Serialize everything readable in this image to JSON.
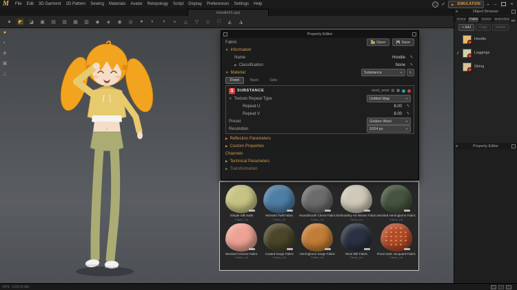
{
  "app": {
    "logo_text": "M",
    "menus": [
      "File",
      "Edit",
      "3D Garment",
      "2D Pattern",
      "Sewing",
      "Materials",
      "Avatar",
      "Retopology",
      "Script",
      "Display",
      "Preferences",
      "Settings",
      "Help"
    ],
    "document_tab": "Hoodie01.zprj",
    "simulation_label": "SIMULATION",
    "status_text": "FPS : 0.00 (0.0K)"
  },
  "toolbar": {
    "icons": [
      "▲",
      "◩",
      "◪",
      "▣",
      "▤",
      "▥",
      "▦",
      "▧",
      "◆",
      "◈",
      "◉",
      "◎",
      "●",
      "◐",
      "◑",
      "◒",
      "△",
      "▽",
      "◇",
      "□",
      "◭",
      "◮"
    ],
    "left_icons": [
      "●",
      "◐",
      "◈",
      "▣",
      "△"
    ]
  },
  "property_editor": {
    "title": "Property Editor",
    "fabric_label": "Fabric",
    "open_label": "Open",
    "save_label": "Save",
    "information": {
      "header": "Information",
      "name_label": "Name",
      "name_value": "Hoodie",
      "classification_label": "Classification",
      "classification_value": "None"
    },
    "material": {
      "header": "Material",
      "type_value": "Substance",
      "tabs": [
        "Front",
        "Back",
        "Side"
      ],
      "substance": {
        "brand": "SUBSTANCE",
        "file_name": "wool_wovi",
        "texture_repeat_label": "Texture Repeat Type",
        "texture_repeat_value": "Unified Map",
        "repeat_u_label": "Repeat U",
        "repeat_u_value": "8.00",
        "repeat_v_label": "Repeat V",
        "repeat_v_value": "8.00",
        "preset_label": "Preset",
        "preset_value": "Golden Wool",
        "resolution_label": "Resolution",
        "resolution_value": "1024 px"
      },
      "reflection_header": "Reflection Parameters",
      "custom_header": "Custom Properties",
      "channels_header": "Channels",
      "technical_header": "Technical Parameters",
      "transformation_header": "Transformation"
    }
  },
  "swatch_panel": {
    "items": [
      {
        "name": "Simple Silk Satin",
        "lib": "Fabric_Lib",
        "color": "#c6c383"
      },
      {
        "name": "Worsted Twill Fabric",
        "lib": "Fabric_Lib",
        "color": "#4e7da5"
      },
      {
        "name": "Houndstooth Check Fabric",
        "lib": "Fabric_Lib",
        "color": "#6b6b6b"
      },
      {
        "name": "Embroidery Art Woven Fabric",
        "lib": "Fabric_Lib",
        "color": "#cfc8b8"
      },
      {
        "name": "Worsted Herringbone Fabric",
        "lib": "Fabric_Lib",
        "color": "#45543e"
      },
      {
        "name": "Worsted Cheviot Fabric",
        "lib": "Fabric_Lib",
        "color": "#eda294"
      },
      {
        "name": "Coated Serge Fabric",
        "lib": "Fabric_Lib",
        "color": "#4b4629"
      },
      {
        "name": "Herringbone Serge Fabric",
        "lib": "Fabric_Lib",
        "color": "#c17c35"
      },
      {
        "name": "Wool Silk Fabric",
        "lib": "Fabric_Lib",
        "color": "#2b3142"
      },
      {
        "name": "Floral Satin Jacquard Fabric",
        "lib": "Fabric_Lib",
        "color": "#b54a2b"
      }
    ]
  },
  "object_browser": {
    "title": "Object Browser",
    "tabs": [
      "Scene",
      "Fabric",
      "Button",
      "Buttonhole"
    ],
    "add_label": "Add",
    "copy_label": "Copy",
    "delete_label": "Delete",
    "items": [
      {
        "name": "Hoodie",
        "color": "#e2bf6b"
      },
      {
        "name": "Leggings",
        "color": "#cfd2a6"
      },
      {
        "name": "String",
        "color": "#d8c291"
      }
    ]
  },
  "sidebar": {
    "property_editor_title": "Property Editor"
  }
}
